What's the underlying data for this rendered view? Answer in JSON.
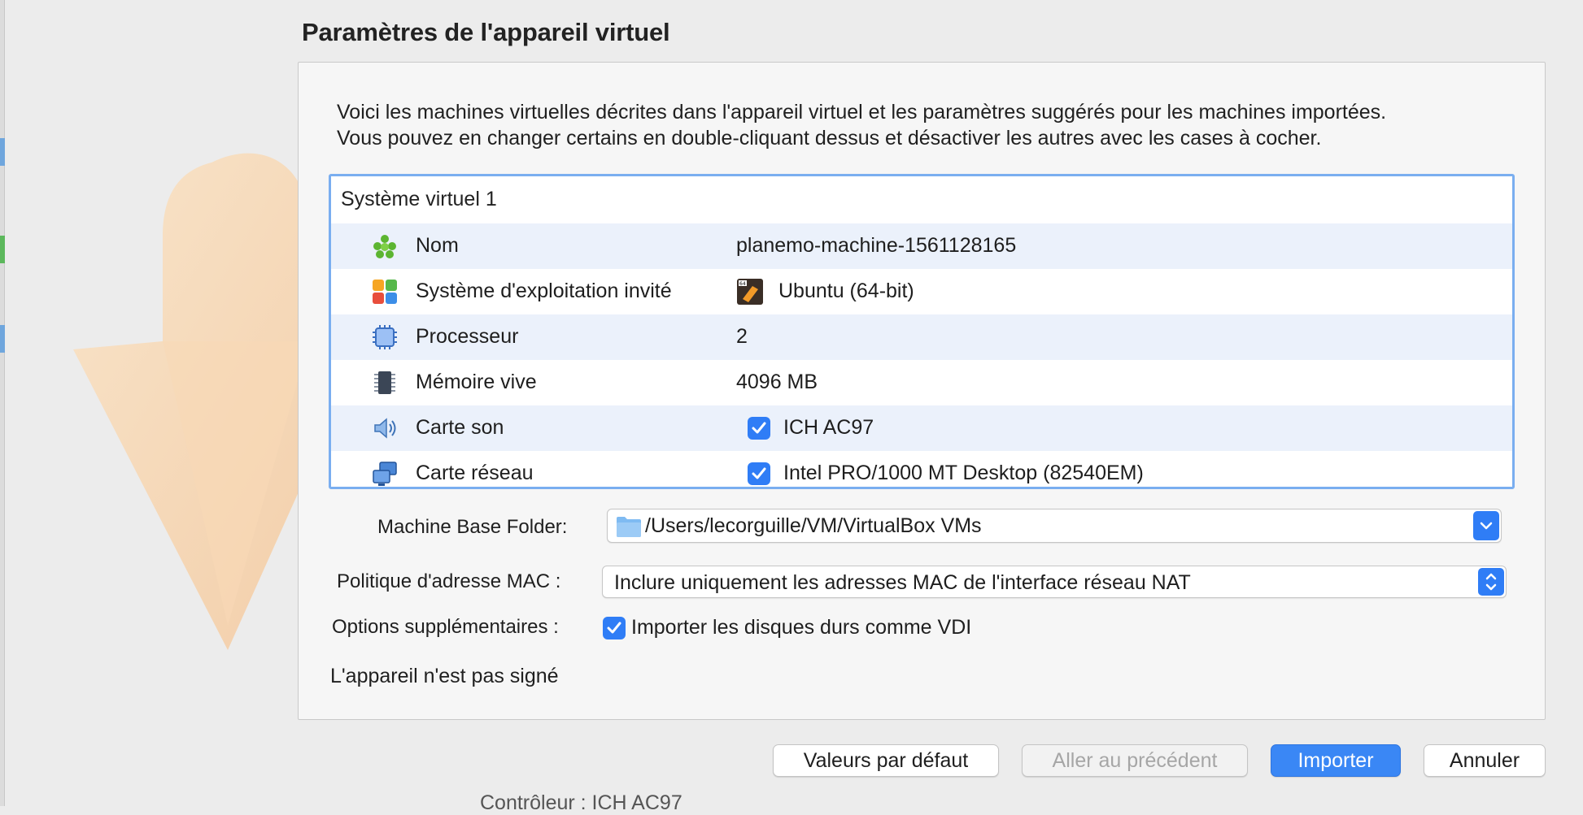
{
  "dialog": {
    "title": "Paramètres de l'appareil virtuel",
    "intro_line1": "Voici les machines virtuelles décrites dans l'appareil virtuel et les paramètres suggérés pour les machines importées.",
    "intro_line2": "Vous pouvez en changer certains en double-cliquant dessus et désactiver les autres avec les cases à cocher."
  },
  "tree": {
    "header": "Système virtuel 1",
    "rows": [
      {
        "icon": "name-icon",
        "label": "Nom",
        "value": "planemo-machine-1561128165"
      },
      {
        "icon": "os-icon",
        "label": "Système d'exploitation invité",
        "value_icon": "ubuntu-64-icon",
        "value": "Ubuntu (64-bit)"
      },
      {
        "icon": "cpu-icon",
        "label": "Processeur",
        "value": "2"
      },
      {
        "icon": "ram-icon",
        "label": "Mémoire vive",
        "value": "4096 MB"
      },
      {
        "icon": "sound-icon",
        "label": "Carte son",
        "checked": true,
        "value": "ICH AC97"
      },
      {
        "icon": "network-icon",
        "label": "Carte réseau",
        "checked": true,
        "value": "Intel PRO/1000 MT Desktop (82540EM)"
      }
    ]
  },
  "fields": {
    "base_folder_label": "Machine Base Folder:",
    "base_folder_value": "/Users/lecorguille/VM/VirtualBox VMs",
    "mac_policy_label": "Politique d'adresse MAC :",
    "mac_policy_value": "Inclure uniquement les adresses MAC de l'interface réseau NAT",
    "extra_options_label": "Options supplémentaires :",
    "import_vdi_label": "Importer les disques durs comme VDI",
    "import_vdi_checked": true,
    "signature_status": "L'appareil n'est pas signé"
  },
  "buttons": {
    "defaults": "Valeurs par défaut",
    "back": "Aller au précédent",
    "import": "Importer",
    "cancel": "Annuler"
  },
  "background_text": "Contrôleur : ICH AC97",
  "colors": {
    "accent": "#2f7df6",
    "selection_border": "#7aaef0",
    "row_alt": "#ebf1fb"
  }
}
